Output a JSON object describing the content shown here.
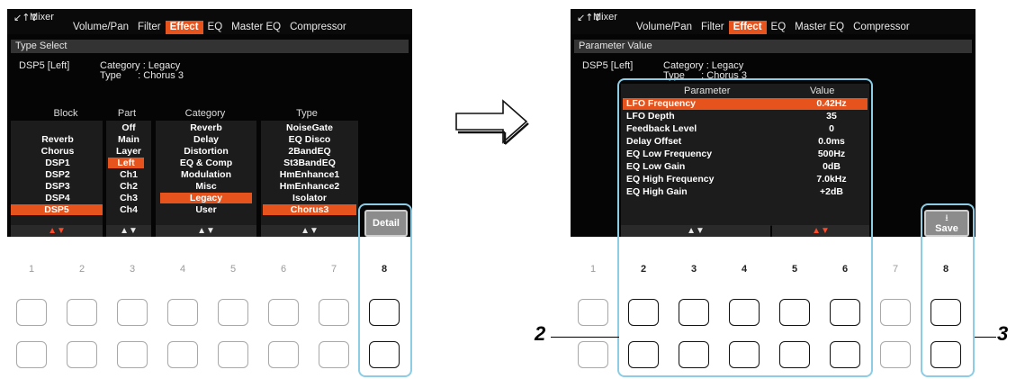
{
  "left_screen": {
    "mixer_icon": "↙↑↕",
    "title": "Mixer",
    "tabs": [
      {
        "label": "Volume/Pan",
        "active": false
      },
      {
        "label": "Filter",
        "active": false
      },
      {
        "label": "Effect",
        "active": true
      },
      {
        "label": "EQ",
        "active": false
      },
      {
        "label": "Master EQ",
        "active": false
      },
      {
        "label": "Compressor",
        "active": false
      }
    ],
    "section_title": "Type Select",
    "dsp_label": "DSP5 [Left]",
    "category_line": "Category : Legacy",
    "type_line": "Type      : Chorus 3",
    "columns": {
      "block": {
        "header": "Block",
        "items": [
          "Reverb",
          "Chorus",
          "DSP1",
          "DSP2",
          "DSP3",
          "DSP4",
          "DSP5"
        ],
        "selected": "DSP5",
        "arrows": "▲▼"
      },
      "part": {
        "header": "Part",
        "items": [
          "Off",
          "Main",
          "Layer",
          "Left",
          "Ch1",
          "Ch2",
          "Ch3",
          "Ch4"
        ],
        "selected": "Left",
        "arrows": "▲▼"
      },
      "category": {
        "header": "Category",
        "items": [
          "Reverb",
          "Delay",
          "Distortion",
          "EQ & Comp",
          "Modulation",
          "Misc",
          "Legacy",
          "User"
        ],
        "selected": "Legacy",
        "arrows": "▲▼"
      },
      "type": {
        "header": "Type",
        "items": [
          "NoiseGate",
          "EQ Disco",
          "2BandEQ",
          "St3BandEQ",
          "HmEnhance1",
          "HmEnhance2",
          "Isolator",
          "Chorus3"
        ],
        "selected": "Chorus3",
        "arrows": "▲▼"
      }
    },
    "detail_button": "Detail",
    "button_numbers": [
      "1",
      "2",
      "3",
      "4",
      "5",
      "6",
      "7",
      "8"
    ]
  },
  "arrow_between": "right-arrow",
  "right_screen": {
    "mixer_icon": "↙↑↕",
    "title": "Mixer",
    "tabs": [
      {
        "label": "Volume/Pan",
        "active": false
      },
      {
        "label": "Filter",
        "active": false
      },
      {
        "label": "Effect",
        "active": true
      },
      {
        "label": "EQ",
        "active": false
      },
      {
        "label": "Master EQ",
        "active": false
      },
      {
        "label": "Compressor",
        "active": false
      }
    ],
    "section_title": "Parameter Value",
    "dsp_label": "DSP5 [Left]",
    "category_line": "Category : Legacy",
    "type_line": "Type      : Chorus 3",
    "table": {
      "param_header": "Parameter",
      "value_header": "Value",
      "rows": [
        {
          "parameter": "LFO Frequency",
          "value": "0.42Hz",
          "selected": true
        },
        {
          "parameter": "LFO Depth",
          "value": "35",
          "selected": false
        },
        {
          "parameter": "Feedback Level",
          "value": "0",
          "selected": false
        },
        {
          "parameter": "Delay Offset",
          "value": "0.0ms",
          "selected": false
        },
        {
          "parameter": "EQ Low Frequency",
          "value": "500Hz",
          "selected": false
        },
        {
          "parameter": "EQ Low Gain",
          "value": "0dB",
          "selected": false
        },
        {
          "parameter": "EQ High Frequency",
          "value": "7.0kHz",
          "selected": false
        },
        {
          "parameter": "EQ High Gain",
          "value": "+2dB",
          "selected": false
        }
      ],
      "arrows_param": "▲▼",
      "arrows_value": "▲▼"
    },
    "save_icon": "⭳",
    "save_button": "Save",
    "button_numbers": [
      "1",
      "2",
      "3",
      "4",
      "5",
      "6",
      "7",
      "8"
    ]
  },
  "step_labels": {
    "step2": "2",
    "step3": "3"
  },
  "colors": {
    "accent": "#e6531c",
    "highlight": "#8ccce4",
    "screen_bg": "#050505"
  }
}
